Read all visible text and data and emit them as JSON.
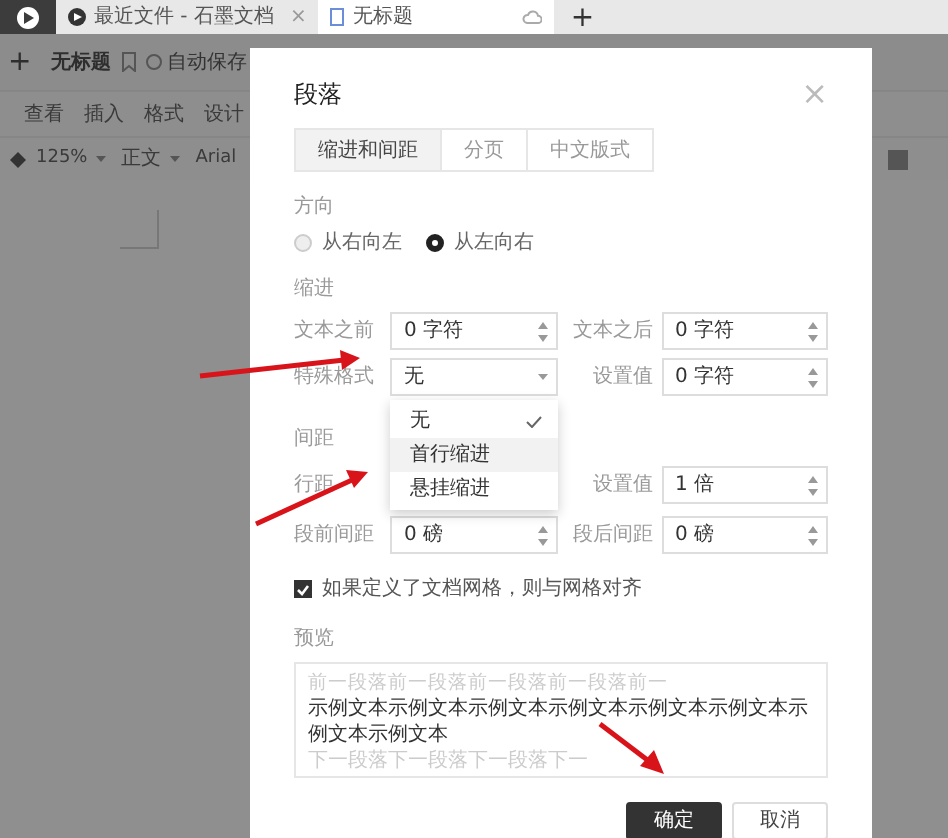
{
  "app_tabs": [
    {
      "label": "最近文件 - 石墨文档",
      "selected": false,
      "close": "×"
    },
    {
      "label": "无标题",
      "selected": true
    }
  ],
  "new_tab": "+",
  "doc_header": {
    "new": "+",
    "title": "无标题",
    "autosave": "自动保存"
  },
  "menu": [
    "查看",
    "插入",
    "格式",
    "设计"
  ],
  "toolbar": {
    "zoom": "125%",
    "style": "正文",
    "font": "Arial"
  },
  "dialog": {
    "title": "段落",
    "close": "×",
    "tabs": [
      {
        "label": "缩进和间距",
        "selected": true
      },
      {
        "label": "分页",
        "selected": false
      },
      {
        "label": "中文版式",
        "selected": false
      }
    ],
    "direction": {
      "label": "方向",
      "options": [
        {
          "label": "从右向左",
          "selected": false
        },
        {
          "label": "从左向右",
          "selected": true
        }
      ]
    },
    "indent": {
      "label": "缩进",
      "rows": [
        [
          {
            "label": "文本之前",
            "value": "0 字符",
            "kind": "spinner"
          },
          {
            "label": "文本之后",
            "value": "0 字符",
            "kind": "spinner"
          }
        ],
        [
          {
            "label": "特殊格式",
            "value": "无",
            "kind": "select"
          },
          {
            "label": "设置值",
            "value": "0 字符",
            "kind": "spinner"
          }
        ]
      ]
    },
    "spacing": {
      "label": "间距",
      "rows": [
        [
          {
            "label": "行距"
          },
          {
            "label": "设置值",
            "value": "1 倍",
            "kind": "spinner"
          }
        ],
        [
          {
            "label": "段前间距",
            "value": "0 磅",
            "kind": "spinner"
          },
          {
            "label": "段后间距",
            "value": "0 磅",
            "kind": "spinner"
          }
        ]
      ]
    },
    "dropdown": {
      "options": [
        {
          "label": "无",
          "selected": true,
          "highlighted": false
        },
        {
          "label": "首行缩进",
          "selected": false,
          "highlighted": true
        },
        {
          "label": "悬挂缩进",
          "selected": false,
          "highlighted": false
        }
      ]
    },
    "grid_checkbox": {
      "label": "如果定义了文档网格，则与网格对齐",
      "checked": true
    },
    "preview": {
      "label": "预览",
      "before": "前一段落前一段落前一段落前一段落前一",
      "sample": "示例文本示例文本示例文本示例文本示例文本示例文本示例文本示例文本",
      "after": "下一段落下一段落下一段落下一"
    },
    "buttons": [
      {
        "label": "确定",
        "kind": "primary"
      },
      {
        "label": "取消",
        "kind": "secondary"
      }
    ]
  }
}
